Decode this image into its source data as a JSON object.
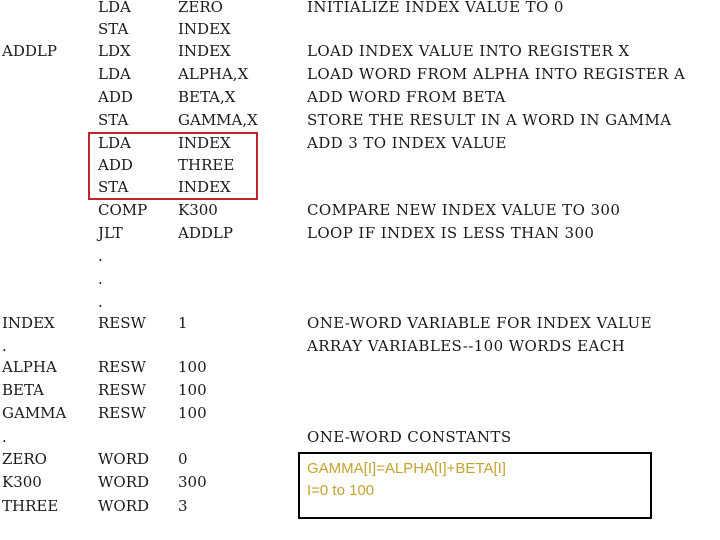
{
  "code_lines": [
    {
      "label": "",
      "op": "LDA",
      "arg": "ZERO",
      "comment": "INITIALIZE INDEX VALUE TO 0"
    },
    {
      "label": "",
      "op": "STA",
      "arg": "INDEX",
      "comment": ""
    },
    {
      "label": "ADDLP",
      "op": "LDX",
      "arg": "INDEX",
      "comment": "LOAD INDEX VALUE INTO REGISTER X"
    },
    {
      "label": "",
      "op": "LDA",
      "arg": "ALPHA,X",
      "comment": "LOAD WORD FROM ALPHA INTO REGISTER A"
    },
    {
      "label": "",
      "op": "ADD",
      "arg": "BETA,X",
      "comment": "ADD WORD FROM BETA"
    },
    {
      "label": "",
      "op": "STA",
      "arg": "GAMMA,X",
      "comment": "STORE THE RESULT IN A WORD IN GAMMA"
    },
    {
      "label": "",
      "op": "LDA",
      "arg": "INDEX",
      "comment": "ADD 3 TO INDEX VALUE"
    },
    {
      "label": "",
      "op": "ADD",
      "arg": "THREE",
      "comment": ""
    },
    {
      "label": "",
      "op": "STA",
      "arg": "INDEX",
      "comment": ""
    },
    {
      "label": "",
      "op": "COMP",
      "arg": "K300",
      "comment": "COMPARE NEW INDEX VALUE TO 300"
    },
    {
      "label": "",
      "op": "JLT",
      "arg": "ADDLP",
      "comment": "LOOP IF INDEX IS LESS THAN 300"
    },
    {
      "label": "",
      "op": ".",
      "arg": "",
      "comment": ""
    },
    {
      "label": "",
      "op": ".",
      "arg": "",
      "comment": ""
    },
    {
      "label": "",
      "op": ".",
      "arg": "",
      "comment": ""
    },
    {
      "label": "INDEX",
      "op": "RESW",
      "arg": "1",
      "comment": "ONE-WORD VARIABLE FOR INDEX VALUE"
    },
    {
      "label": ".",
      "op": "",
      "arg": "",
      "comment": "ARRAY VARIABLES--100 WORDS EACH"
    },
    {
      "label": "ALPHA",
      "op": "RESW",
      "arg": "100",
      "comment": ""
    },
    {
      "label": "BETA",
      "op": "RESW",
      "arg": "100",
      "comment": ""
    },
    {
      "label": "GAMMA",
      "op": "RESW",
      "arg": "100",
      "comment": ""
    },
    {
      "label": ".",
      "op": "",
      "arg": "",
      "comment": "ONE-WORD CONSTANTS"
    },
    {
      "label": "ZERO",
      "op": "WORD",
      "arg": "0",
      "comment": ""
    },
    {
      "label": "K300",
      "op": "WORD",
      "arg": "300",
      "comment": ""
    },
    {
      "label": "THREE",
      "op": "WORD",
      "arg": "3",
      "comment": ""
    }
  ],
  "highlight": {
    "description": "index increment instructions",
    "color": "#c0272d"
  },
  "note": {
    "line1": "GAMMA[I]=ALPHA[I]+BETA[I]",
    "line2": "I=0 to 100",
    "color": "#c4a22f"
  }
}
